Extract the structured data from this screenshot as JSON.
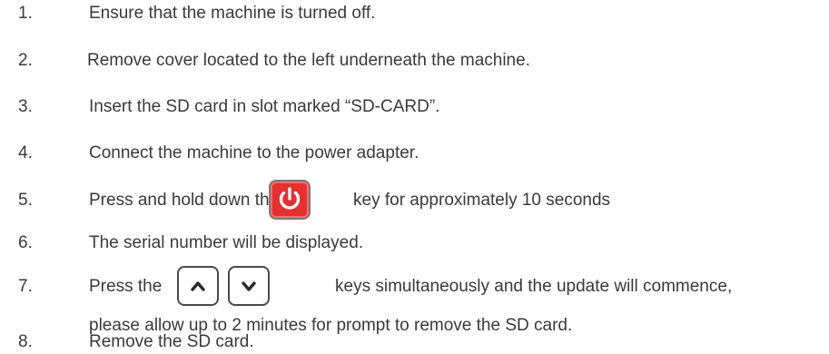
{
  "steps": [
    {
      "num": "1.",
      "text": "Ensure that the machine is turned off."
    },
    {
      "num": "2.",
      "text": "Remove cover located to the left underneath the machine."
    },
    {
      "num": "3.",
      "text": "Insert the SD card in slot marked “SD-CARD”."
    },
    {
      "num": "4.",
      "text": "Connect the machine to the power adapter."
    },
    {
      "num": "5.",
      "text_before": "Press and hold down the",
      "text_after": "key for approximately 10 seconds"
    },
    {
      "num": "6.",
      "text": "The serial number will be displayed."
    },
    {
      "num": "7.",
      "text_before": "Press the",
      "text_after": "keys simultaneously and the update will commence,",
      "text_line2": "please allow up to 2 minutes for prompt to remove the SD card."
    },
    {
      "num": "8.",
      "text": "Remove the SD card."
    }
  ],
  "icons": {
    "power": "power-icon",
    "up": "chevron-up-icon",
    "down": "chevron-down-icon"
  },
  "colors": {
    "text": "#3a3a3a",
    "power_button": "#e62f2f"
  }
}
